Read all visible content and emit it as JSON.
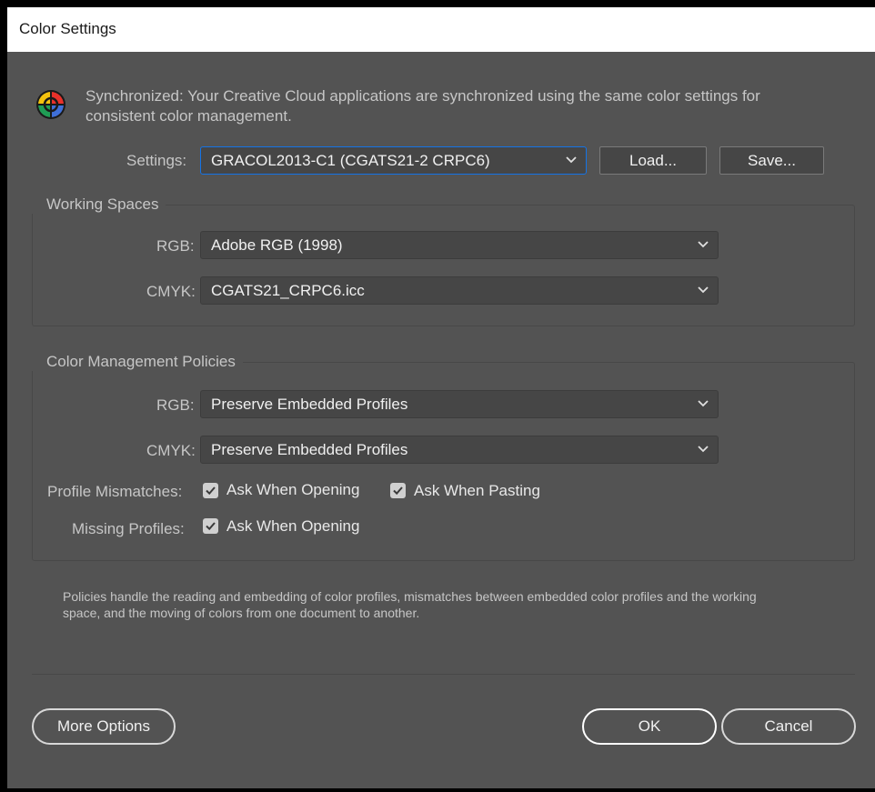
{
  "window": {
    "title": "Color Settings"
  },
  "sync": {
    "icon": "sync-color-wheel-icon",
    "line1": "Synchronized: Your Creative Cloud applications are synchronized using the same color settings for",
    "line2": "consistent color management."
  },
  "settings": {
    "label": "Settings:",
    "value": "GRACOL2013-C1 (CGATS21-2 CRPC6)",
    "load_label": "Load...",
    "save_label": "Save..."
  },
  "working_spaces": {
    "title": "Working Spaces",
    "rgb_label": "RGB:",
    "rgb_value": "Adobe RGB (1998)",
    "cmyk_label": "CMYK:",
    "cmyk_value": "CGATS21_CRPC6.icc"
  },
  "policies": {
    "title": "Color Management Policies",
    "rgb_label": "RGB:",
    "rgb_value": "Preserve Embedded Profiles",
    "cmyk_label": "CMYK:",
    "cmyk_value": "Preserve Embedded Profiles",
    "mismatch_label": "Profile Mismatches:",
    "ask_opening": "Ask When Opening",
    "ask_pasting": "Ask When Pasting",
    "missing_label": "Missing Profiles:",
    "missing_ask_opening": "Ask When Opening",
    "checked": {
      "mismatch_opening": true,
      "mismatch_pasting": true,
      "missing_opening": true
    }
  },
  "description": {
    "line1": "Policies handle the reading and embedding of color profiles, mismatches between embedded color profiles and the working",
    "line2": "space, and the moving of colors from one document to another."
  },
  "buttons": {
    "more_options": "More Options",
    "ok": "OK",
    "cancel": "Cancel"
  },
  "colors": {
    "dialog_bg": "#535353",
    "field_bg": "#464646",
    "focus_accent": "#1473e6",
    "text": "#c6c6c6"
  }
}
